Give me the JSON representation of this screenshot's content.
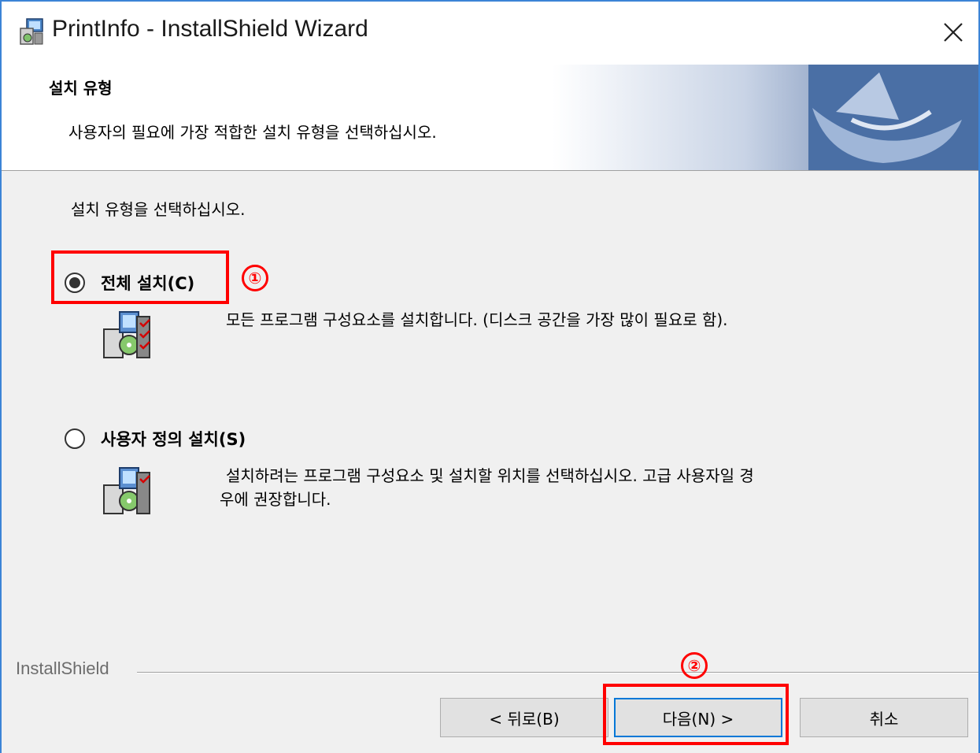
{
  "window": {
    "title": "PrintInfo - InstallShield Wizard"
  },
  "header": {
    "title": "설치 유형",
    "subtitle": "사용자의 필요에 가장 적합한 설치 유형을 선택하십시오."
  },
  "main": {
    "prompt": "설치 유형을 선택하십시오.",
    "options": [
      {
        "label": "전체 설치(C)",
        "description": "모든 프로그램 구성요소를 설치합니다. (디스크 공간을 가장 많이 필요로 함).",
        "selected": true
      },
      {
        "label": "사용자 정의 설치(S)",
        "description_line1": "설치하려는 프로그램 구성요소 및 설치할 위치를 선택하십시오. 고급 사용자일 경",
        "description_line2": "우에 권장합니다.",
        "selected": false
      }
    ]
  },
  "annotations": {
    "marker1": "①",
    "marker2": "②",
    "color": "#ff0000"
  },
  "footer": {
    "brand": "InstallShield",
    "back_label": "< 뒤로(B)",
    "next_label": "다음(N) >",
    "cancel_label": "취소"
  },
  "colors": {
    "window_border": "#3c84d6",
    "default_button_border": "#0078d7",
    "header_art": "#4a6fa5"
  }
}
